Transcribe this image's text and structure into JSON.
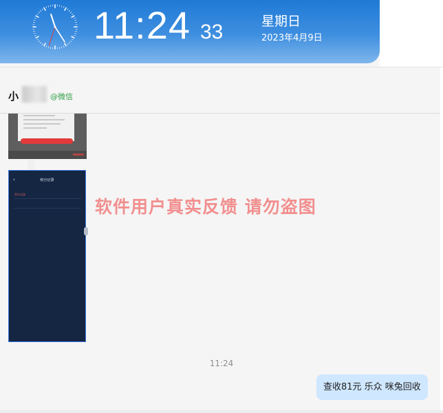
{
  "clock": {
    "time_hm": "11:24",
    "time_sec": "33",
    "weekday": "星期日",
    "date": "2023年4月9日",
    "hour": 11,
    "minute": 24,
    "second": 33
  },
  "chat": {
    "contact_name": "小",
    "contact_tag": "@微信"
  },
  "attachments": [
    {
      "title": ""
    },
    {
      "title": "积分记录",
      "section_label": "积分记录"
    }
  ],
  "watermark": "软件用户真实反馈  请勿盗图",
  "messages": [
    {
      "time": "11:24",
      "text": "查收81元  乐众 咪兔回收"
    }
  ],
  "colors": {
    "banner": "#1f7ad6",
    "bubble": "#cfe7ff",
    "watermark": "#f28f8f",
    "tag_green": "#2fa046"
  }
}
